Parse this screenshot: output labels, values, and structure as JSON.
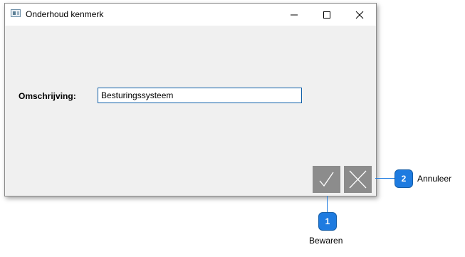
{
  "window": {
    "title": "Onderhoud kenmerk"
  },
  "form": {
    "description_label": "Omschrijving:",
    "description_value": "Besturingssysteem"
  },
  "callouts": [
    {
      "number": "1",
      "label": "Bewaren"
    },
    {
      "number": "2",
      "label": "Annuleer"
    }
  ],
  "colors": {
    "callout": "#1e7be0",
    "input_border": "#0f5fa8",
    "action_button": "#8c8c8c",
    "window_background": "#f0f0f0"
  },
  "icons": {
    "save": "checkmark-icon",
    "cancel": "x-icon"
  }
}
